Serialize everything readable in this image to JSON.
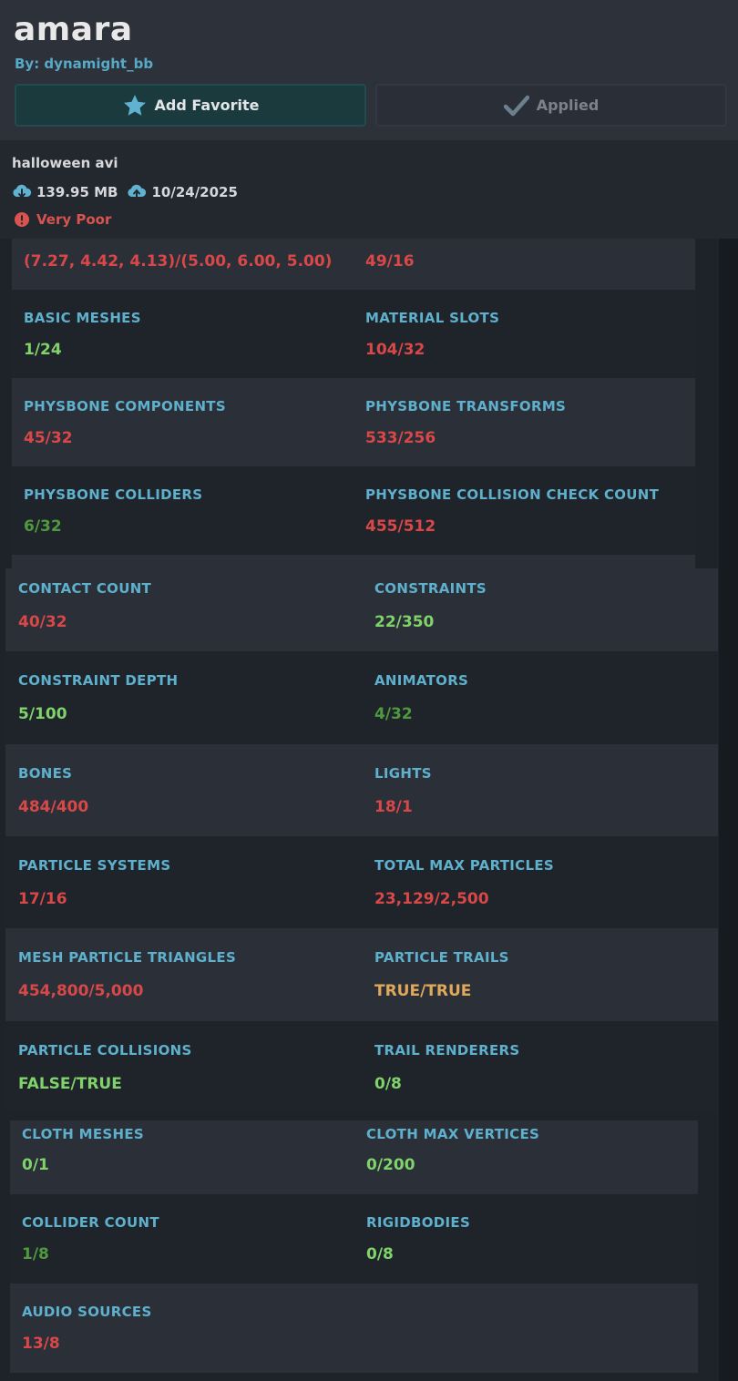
{
  "header": {
    "title": "amara",
    "author": "By: dynamight_bb",
    "favorite_label": "Add Favorite",
    "applied_label": "Applied"
  },
  "info": {
    "description": "halloween avi",
    "file_size": "139.95 MB",
    "date": "10/24/2025",
    "rating": "Very Poor"
  },
  "stats": {
    "bounds": {
      "label": "",
      "value": "(7.27, 4.42, 4.13)/(5.00, 6.00, 5.00)"
    },
    "bounds_count": {
      "label": "",
      "value": "49/16"
    },
    "basic_meshes": {
      "label": "BASIC MESHES",
      "value": "1/24"
    },
    "material_slots": {
      "label": "MATERIAL SLOTS",
      "value": "104/32"
    },
    "physbone_components": {
      "label": "PHYSBONE COMPONENTS",
      "value": "45/32"
    },
    "physbone_transforms": {
      "label": "PHYSBONE TRANSFORMS",
      "value": "533/256"
    },
    "physbone_colliders": {
      "label": "PHYSBONE COLLIDERS",
      "value": "6/32"
    },
    "physbone_collision_check_count": {
      "label": "PHYSBONE COLLISION CHECK COUNT",
      "value": "455/512"
    },
    "contact_count": {
      "label": "CONTACT COUNT",
      "value": "40/32"
    },
    "constraints": {
      "label": "CONSTRAINTS",
      "value": "22/350"
    },
    "constraint_depth": {
      "label": "CONSTRAINT DEPTH",
      "value": "5/100"
    },
    "animators": {
      "label": "ANIMATORS",
      "value": "4/32"
    },
    "bones": {
      "label": "BONES",
      "value": "484/400"
    },
    "lights": {
      "label": "LIGHTS",
      "value": "18/1"
    },
    "particle_systems": {
      "label": "PARTICLE SYSTEMS",
      "value": "17/16"
    },
    "total_max_particles": {
      "label": "TOTAL MAX PARTICLES",
      "value": "23,129/2,500"
    },
    "mesh_particle_triangles": {
      "label": "MESH PARTICLE TRIANGLES",
      "value": "454,800/5,000"
    },
    "particle_trails": {
      "label": "PARTICLE TRAILS",
      "value": "TRUE/TRUE"
    },
    "particle_collisions": {
      "label": "PARTICLE COLLISIONS",
      "value": "FALSE/TRUE"
    },
    "trail_renderers": {
      "label": "TRAIL RENDERERS",
      "value": "0/8"
    },
    "cloth_meshes": {
      "label": "CLOTH MESHES",
      "value": "0/1"
    },
    "cloth_max_vertices": {
      "label": "CLOTH MAX VERTICES",
      "value": "0/200"
    },
    "collider_count": {
      "label": "COLLIDER COUNT",
      "value": "1/8"
    },
    "rigidbodies": {
      "label": "RIGIDBODIES",
      "value": "0/8"
    },
    "audio_sources": {
      "label": "AUDIO SOURCES",
      "value": "13/8"
    }
  },
  "colors": {
    "label": "#5eb0cc",
    "bad": "#d94848",
    "good": "#7fd36a",
    "medium": "#4f9a3f",
    "warning": "#e0a95a"
  },
  "icons": {
    "favorite": "star-icon",
    "applied": "checkmark-icon",
    "size": "cloud-download-icon",
    "date": "cloud-upload-icon",
    "rating": "alert-circle-icon"
  }
}
